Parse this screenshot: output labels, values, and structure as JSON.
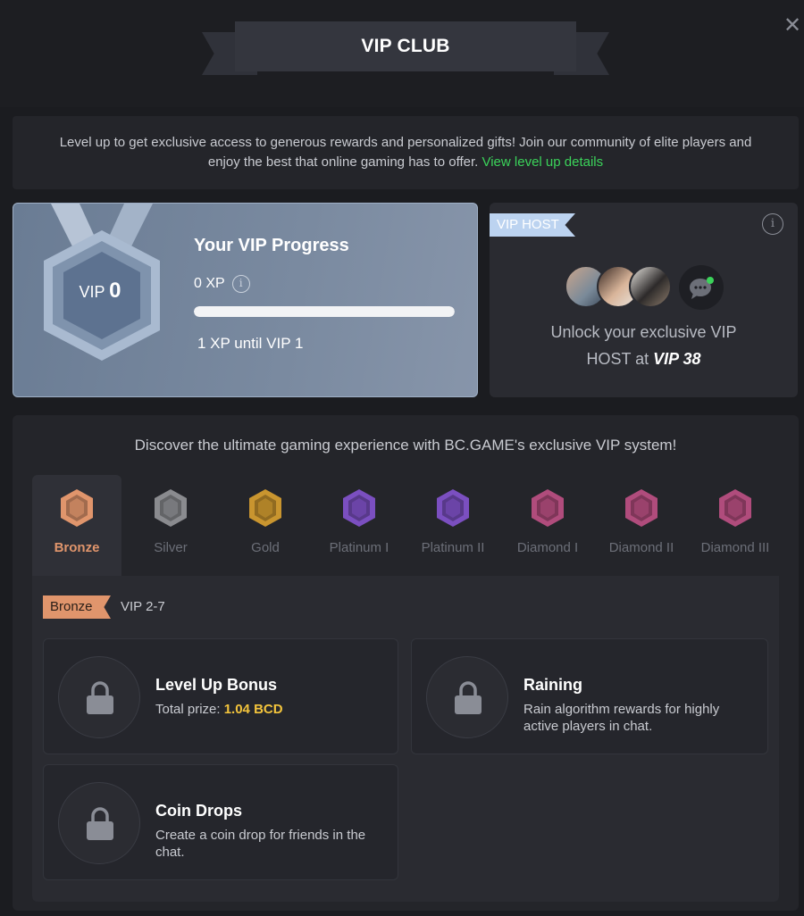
{
  "header": {
    "title": "VIP CLUB",
    "close_icon": "close-icon"
  },
  "intro": {
    "text": "Level up to get exclusive access to generous rewards and personalized gifts! Join our community of elite players and enjoy the best that online gaming has to offer.",
    "link": "View level up details",
    "link_color": "#3bd35a"
  },
  "progress": {
    "medal_label": "VIP",
    "medal_level": "0",
    "title": "Your VIP Progress",
    "xp": "0 XP",
    "bar_fraction": 1.0,
    "until_text": "1 XP until VIP 1"
  },
  "host": {
    "tag": "VIP HOST",
    "text_line1": "Unlock your exclusive VIP",
    "text_line2": "HOST at",
    "level": "VIP 38"
  },
  "discover": {
    "text": "Discover the ultimate gaming experience with BC.GAME's exclusive VIP system!",
    "tiers": [
      {
        "label": "Bronze",
        "color": "#e0956c",
        "active": true
      },
      {
        "label": "Silver",
        "color": "#8a8b8f"
      },
      {
        "label": "Gold",
        "color": "#c9952f"
      },
      {
        "label": "Platinum I",
        "color": "#7b4fc0"
      },
      {
        "label": "Platinum II",
        "color": "#7b4fc0"
      },
      {
        "label": "Diamond I",
        "color": "#b04c7c"
      },
      {
        "label": "Diamond II",
        "color": "#b04c7c"
      },
      {
        "label": "Diamond III",
        "color": "#b04c7c"
      }
    ]
  },
  "tier_detail": {
    "tag": "Bronze",
    "range": "VIP 2-7",
    "perks": [
      {
        "title": "Level Up Bonus",
        "desc_prefix": "Total prize: ",
        "amount": "1.04 BCD"
      },
      {
        "title": "Raining",
        "desc": "Rain algorithm rewards for highly active players in chat."
      },
      {
        "title": "Coin Drops",
        "desc": "Create a coin drop for friends in the chat."
      }
    ]
  }
}
